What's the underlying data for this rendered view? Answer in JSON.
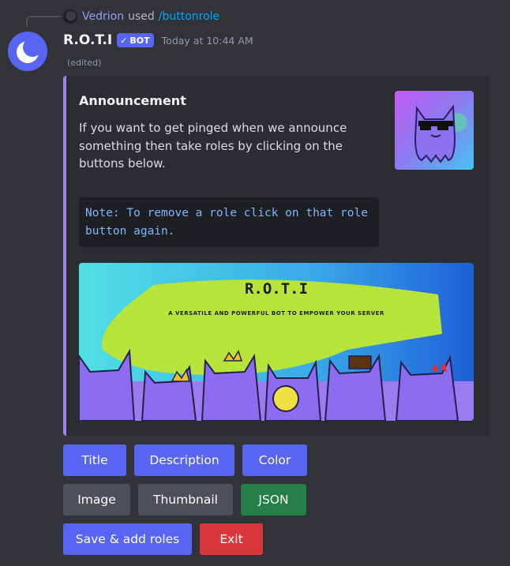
{
  "reply": {
    "user": "Vedrion",
    "used_text": "used",
    "command": "/buttonrole"
  },
  "message": {
    "author": "R.O.T.I",
    "bot_tag": "BOT",
    "timestamp": "Today at 10:44 AM",
    "edited": "(edited)"
  },
  "embed": {
    "accent_color": "#9b84ee",
    "title": "Announcement",
    "description": "If you want to get pinged when we announce something then take roles by clicking on the buttons below.",
    "code_block": "Note: To remove a role click on that role button again.",
    "banner": {
      "title": "R.O.T.I",
      "tagline": "A VERSATILE AND POWERFUL BOT TO EMPOWER YOUR SERVER"
    }
  },
  "buttons": {
    "row1": [
      "Title",
      "Description",
      "Color"
    ],
    "row2": [
      "Image",
      "Thumbnail",
      "JSON"
    ],
    "row3": [
      "Save & add roles",
      "Exit"
    ]
  },
  "colors": {
    "primary": "#5865f2",
    "secondary": "#4e5058",
    "success": "#248046",
    "danger": "#da373c"
  }
}
